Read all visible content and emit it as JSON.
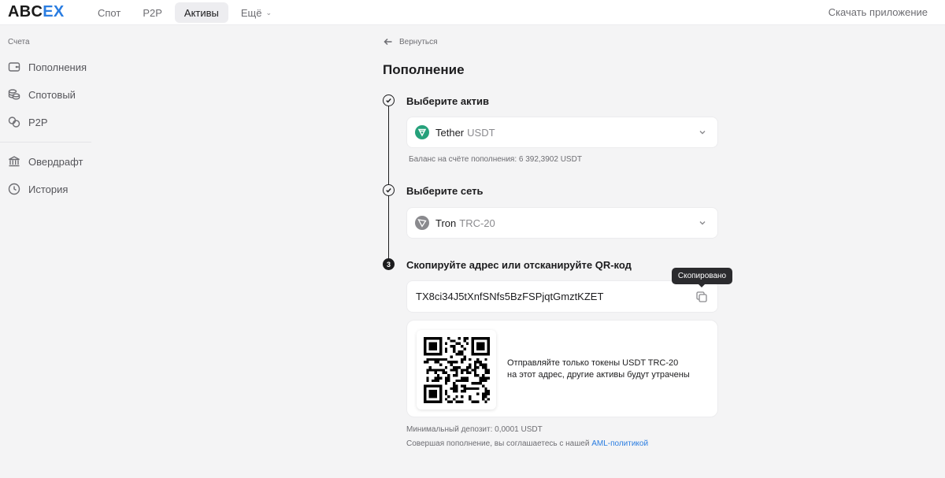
{
  "brand": {
    "logo_part1": "ABC",
    "logo_part2": "EX",
    "accent": "#2a7de1"
  },
  "nav": {
    "items": [
      {
        "label": "Спот"
      },
      {
        "label": "P2P"
      },
      {
        "label": "Активы",
        "active": true
      },
      {
        "label": "Ещё"
      }
    ],
    "download_label": "Скачать приложение"
  },
  "sidebar": {
    "section_title": "Счета",
    "items": [
      {
        "label": "Пополнения",
        "icon": "wallet-icon"
      },
      {
        "label": "Спотовый",
        "icon": "coins-icon"
      },
      {
        "label": "P2P",
        "icon": "p2p-icon"
      },
      {
        "label": "Овердрафт",
        "icon": "bank-icon"
      },
      {
        "label": "История",
        "icon": "clock-icon"
      }
    ]
  },
  "main": {
    "back_label": "Вернуться",
    "title": "Пополнение",
    "steps": [
      {
        "label": "Выберите актив",
        "status": "done"
      },
      {
        "label": "Выберите сеть",
        "status": "done"
      },
      {
        "number": "3",
        "label": "Скопируйте адрес или отсканируйте QR-код",
        "status": "current"
      }
    ],
    "asset": {
      "name": "Tether",
      "ticker": "USDT",
      "icon": "tether-icon",
      "color": "#26a17b"
    },
    "balance_hint": "Баланс на счёте пополнения: 6 392,3902 USDT",
    "network": {
      "name": "Tron",
      "ticker": "TRC-20",
      "icon": "tron-icon",
      "color": "#8a8a8e"
    },
    "address": "TX8ci34J5tXnfSNfs5BzFSPjqtGmztKZET",
    "copied_tooltip": "Скопировано",
    "qr_note_line1": "Отправляйте только токены USDT TRC-20",
    "qr_note_line2": "на этот адрес, другие активы будут утрачены",
    "min_deposit": "Минимальный депозит: 0,0001 USDT",
    "agreement_text": "Совершая пополнение, вы соглашаетесь с нашей",
    "agreement_link": "AML-политикой"
  }
}
